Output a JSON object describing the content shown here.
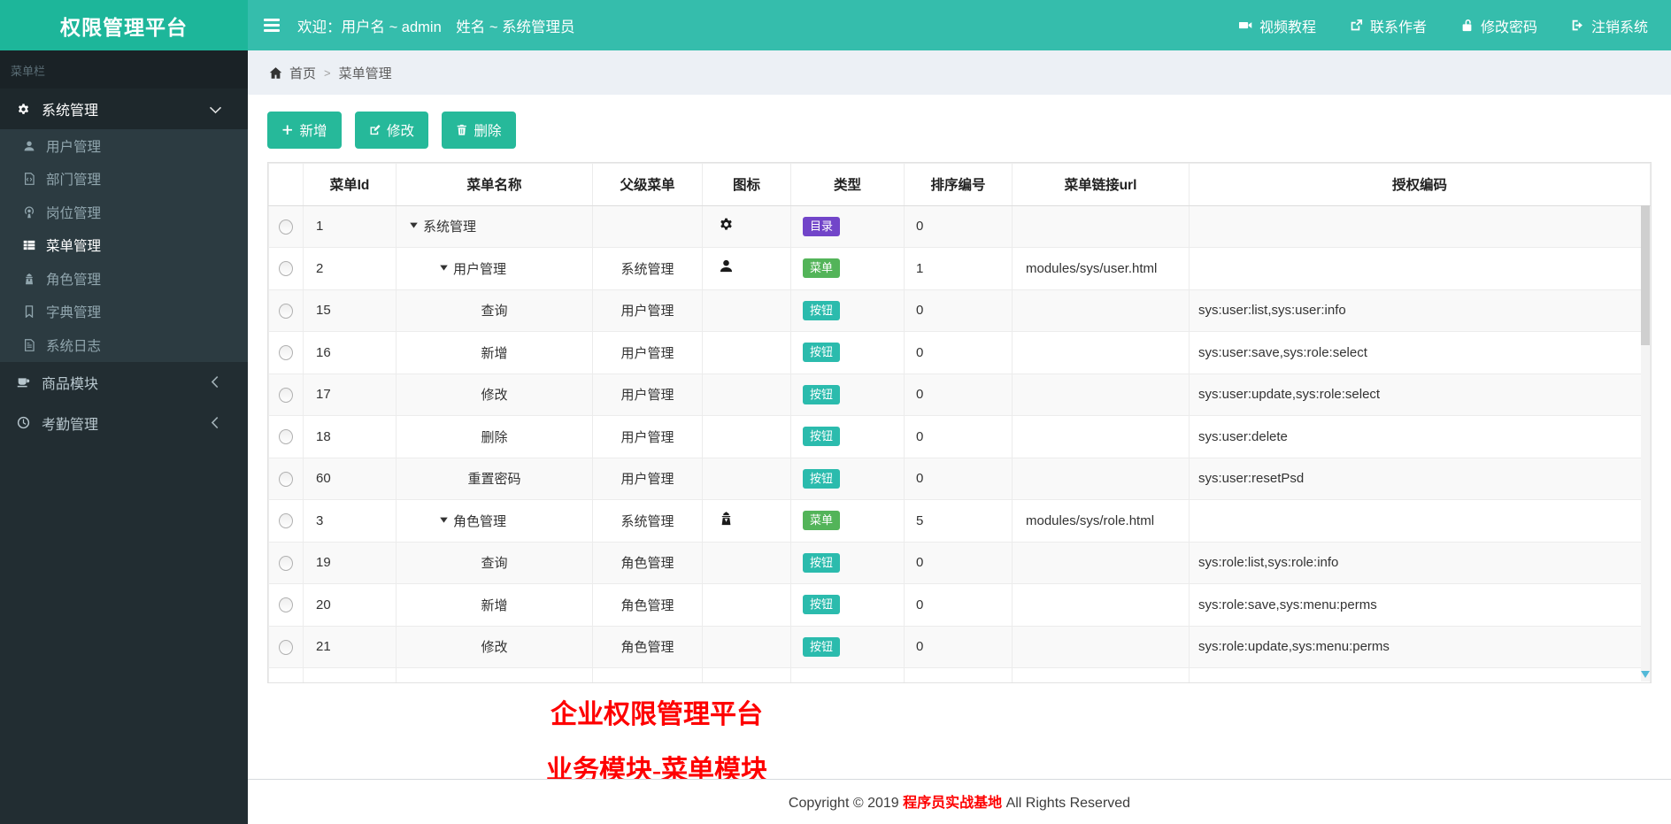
{
  "app": {
    "title": "权限管理平台"
  },
  "topbar": {
    "welcome": "欢迎：用户名 ~ admin　姓名 ~ 系统管理员",
    "links": [
      {
        "label": "视频教程",
        "icon": "video"
      },
      {
        "label": "联系作者",
        "icon": "external-link"
      },
      {
        "label": "修改密码",
        "icon": "unlock"
      },
      {
        "label": "注销系统",
        "icon": "logout"
      }
    ]
  },
  "sidebar": {
    "section_label": "菜单栏",
    "groups": [
      {
        "label": "系统管理",
        "icon": "gear",
        "state": "expanded",
        "active": true,
        "children": [
          {
            "label": "用户管理",
            "icon": "user",
            "active": false
          },
          {
            "label": "部门管理",
            "icon": "file-code",
            "active": false
          },
          {
            "label": "岗位管理",
            "icon": "podcast",
            "active": false
          },
          {
            "label": "菜单管理",
            "icon": "th-list",
            "active": true
          },
          {
            "label": "角色管理",
            "icon": "user-secret",
            "active": false
          },
          {
            "label": "字典管理",
            "icon": "bookmark",
            "active": false
          },
          {
            "label": "系统日志",
            "icon": "file-text",
            "active": false
          }
        ]
      },
      {
        "label": "商品模块",
        "icon": "cup",
        "state": "collapsed",
        "active": false,
        "children": []
      },
      {
        "label": "考勤管理",
        "icon": "clock",
        "state": "collapsed",
        "active": false,
        "children": []
      }
    ]
  },
  "breadcrumb": {
    "home": "首页",
    "separator": ">",
    "current": "菜单管理"
  },
  "toolbar": {
    "add_label": "新增",
    "edit_label": "修改",
    "delete_label": "删除"
  },
  "table": {
    "headers": [
      "",
      "菜单Id",
      "菜单名称",
      "父级菜单",
      "图标",
      "类型",
      "排序编号",
      "菜单链接url",
      "授权编码"
    ],
    "type_colors": {
      "目录": "#7245c9",
      "菜单": "#53b459",
      "按钮": "#2bbbad"
    },
    "rows": [
      {
        "id": "1",
        "name": "系统管理",
        "level": 0,
        "caret": true,
        "parent": "",
        "icon": "gear",
        "type": "目录",
        "sort": "0",
        "url": "",
        "auth": ""
      },
      {
        "id": "2",
        "name": "用户管理",
        "level": 1,
        "caret": true,
        "parent": "系统管理",
        "icon": "user",
        "type": "菜单",
        "sort": "1",
        "url": "modules/sys/user.html",
        "auth": ""
      },
      {
        "id": "15",
        "name": "查询",
        "level": 2,
        "caret": false,
        "parent": "用户管理",
        "icon": "",
        "type": "按钮",
        "sort": "0",
        "url": "",
        "auth": "sys:user:list,sys:user:info"
      },
      {
        "id": "16",
        "name": "新增",
        "level": 2,
        "caret": false,
        "parent": "用户管理",
        "icon": "",
        "type": "按钮",
        "sort": "0",
        "url": "",
        "auth": "sys:user:save,sys:role:select"
      },
      {
        "id": "17",
        "name": "修改",
        "level": 2,
        "caret": false,
        "parent": "用户管理",
        "icon": "",
        "type": "按钮",
        "sort": "0",
        "url": "",
        "auth": "sys:user:update,sys:role:select"
      },
      {
        "id": "18",
        "name": "删除",
        "level": 2,
        "caret": false,
        "parent": "用户管理",
        "icon": "",
        "type": "按钮",
        "sort": "0",
        "url": "",
        "auth": "sys:user:delete"
      },
      {
        "id": "60",
        "name": "重置密码",
        "level": 2,
        "caret": false,
        "parent": "用户管理",
        "icon": "",
        "type": "按钮",
        "sort": "0",
        "url": "",
        "auth": "sys:user:resetPsd"
      },
      {
        "id": "3",
        "name": "角色管理",
        "level": 1,
        "caret": true,
        "parent": "系统管理",
        "icon": "user-secret",
        "type": "菜单",
        "sort": "5",
        "url": "modules/sys/role.html",
        "auth": ""
      },
      {
        "id": "19",
        "name": "查询",
        "level": 2,
        "caret": false,
        "parent": "角色管理",
        "icon": "",
        "type": "按钮",
        "sort": "0",
        "url": "",
        "auth": "sys:role:list,sys:role:info"
      },
      {
        "id": "20",
        "name": "新增",
        "level": 2,
        "caret": false,
        "parent": "角色管理",
        "icon": "",
        "type": "按钮",
        "sort": "0",
        "url": "",
        "auth": "sys:role:save,sys:menu:perms"
      },
      {
        "id": "21",
        "name": "修改",
        "level": 2,
        "caret": false,
        "parent": "角色管理",
        "icon": "",
        "type": "按钮",
        "sort": "0",
        "url": "",
        "auth": "sys:role:update,sys:menu:perms"
      }
    ]
  },
  "banner": {
    "line1": "企业权限管理平台",
    "line2": "业务模块-菜单模块",
    "text_color": "#fe0000"
  },
  "footer": {
    "prefix": "Copyright ©  2019 ",
    "brand": "程序员实战基地",
    "suffix": " All Rights Reserved"
  },
  "colors": {
    "logo_bg": "#1db69a",
    "navbar_bg": "#35bdac",
    "sidebar_bg": "#222d32",
    "submenu_bg": "#2c3b41",
    "accent": "#26b99a",
    "banner_red": "#fe0000"
  }
}
